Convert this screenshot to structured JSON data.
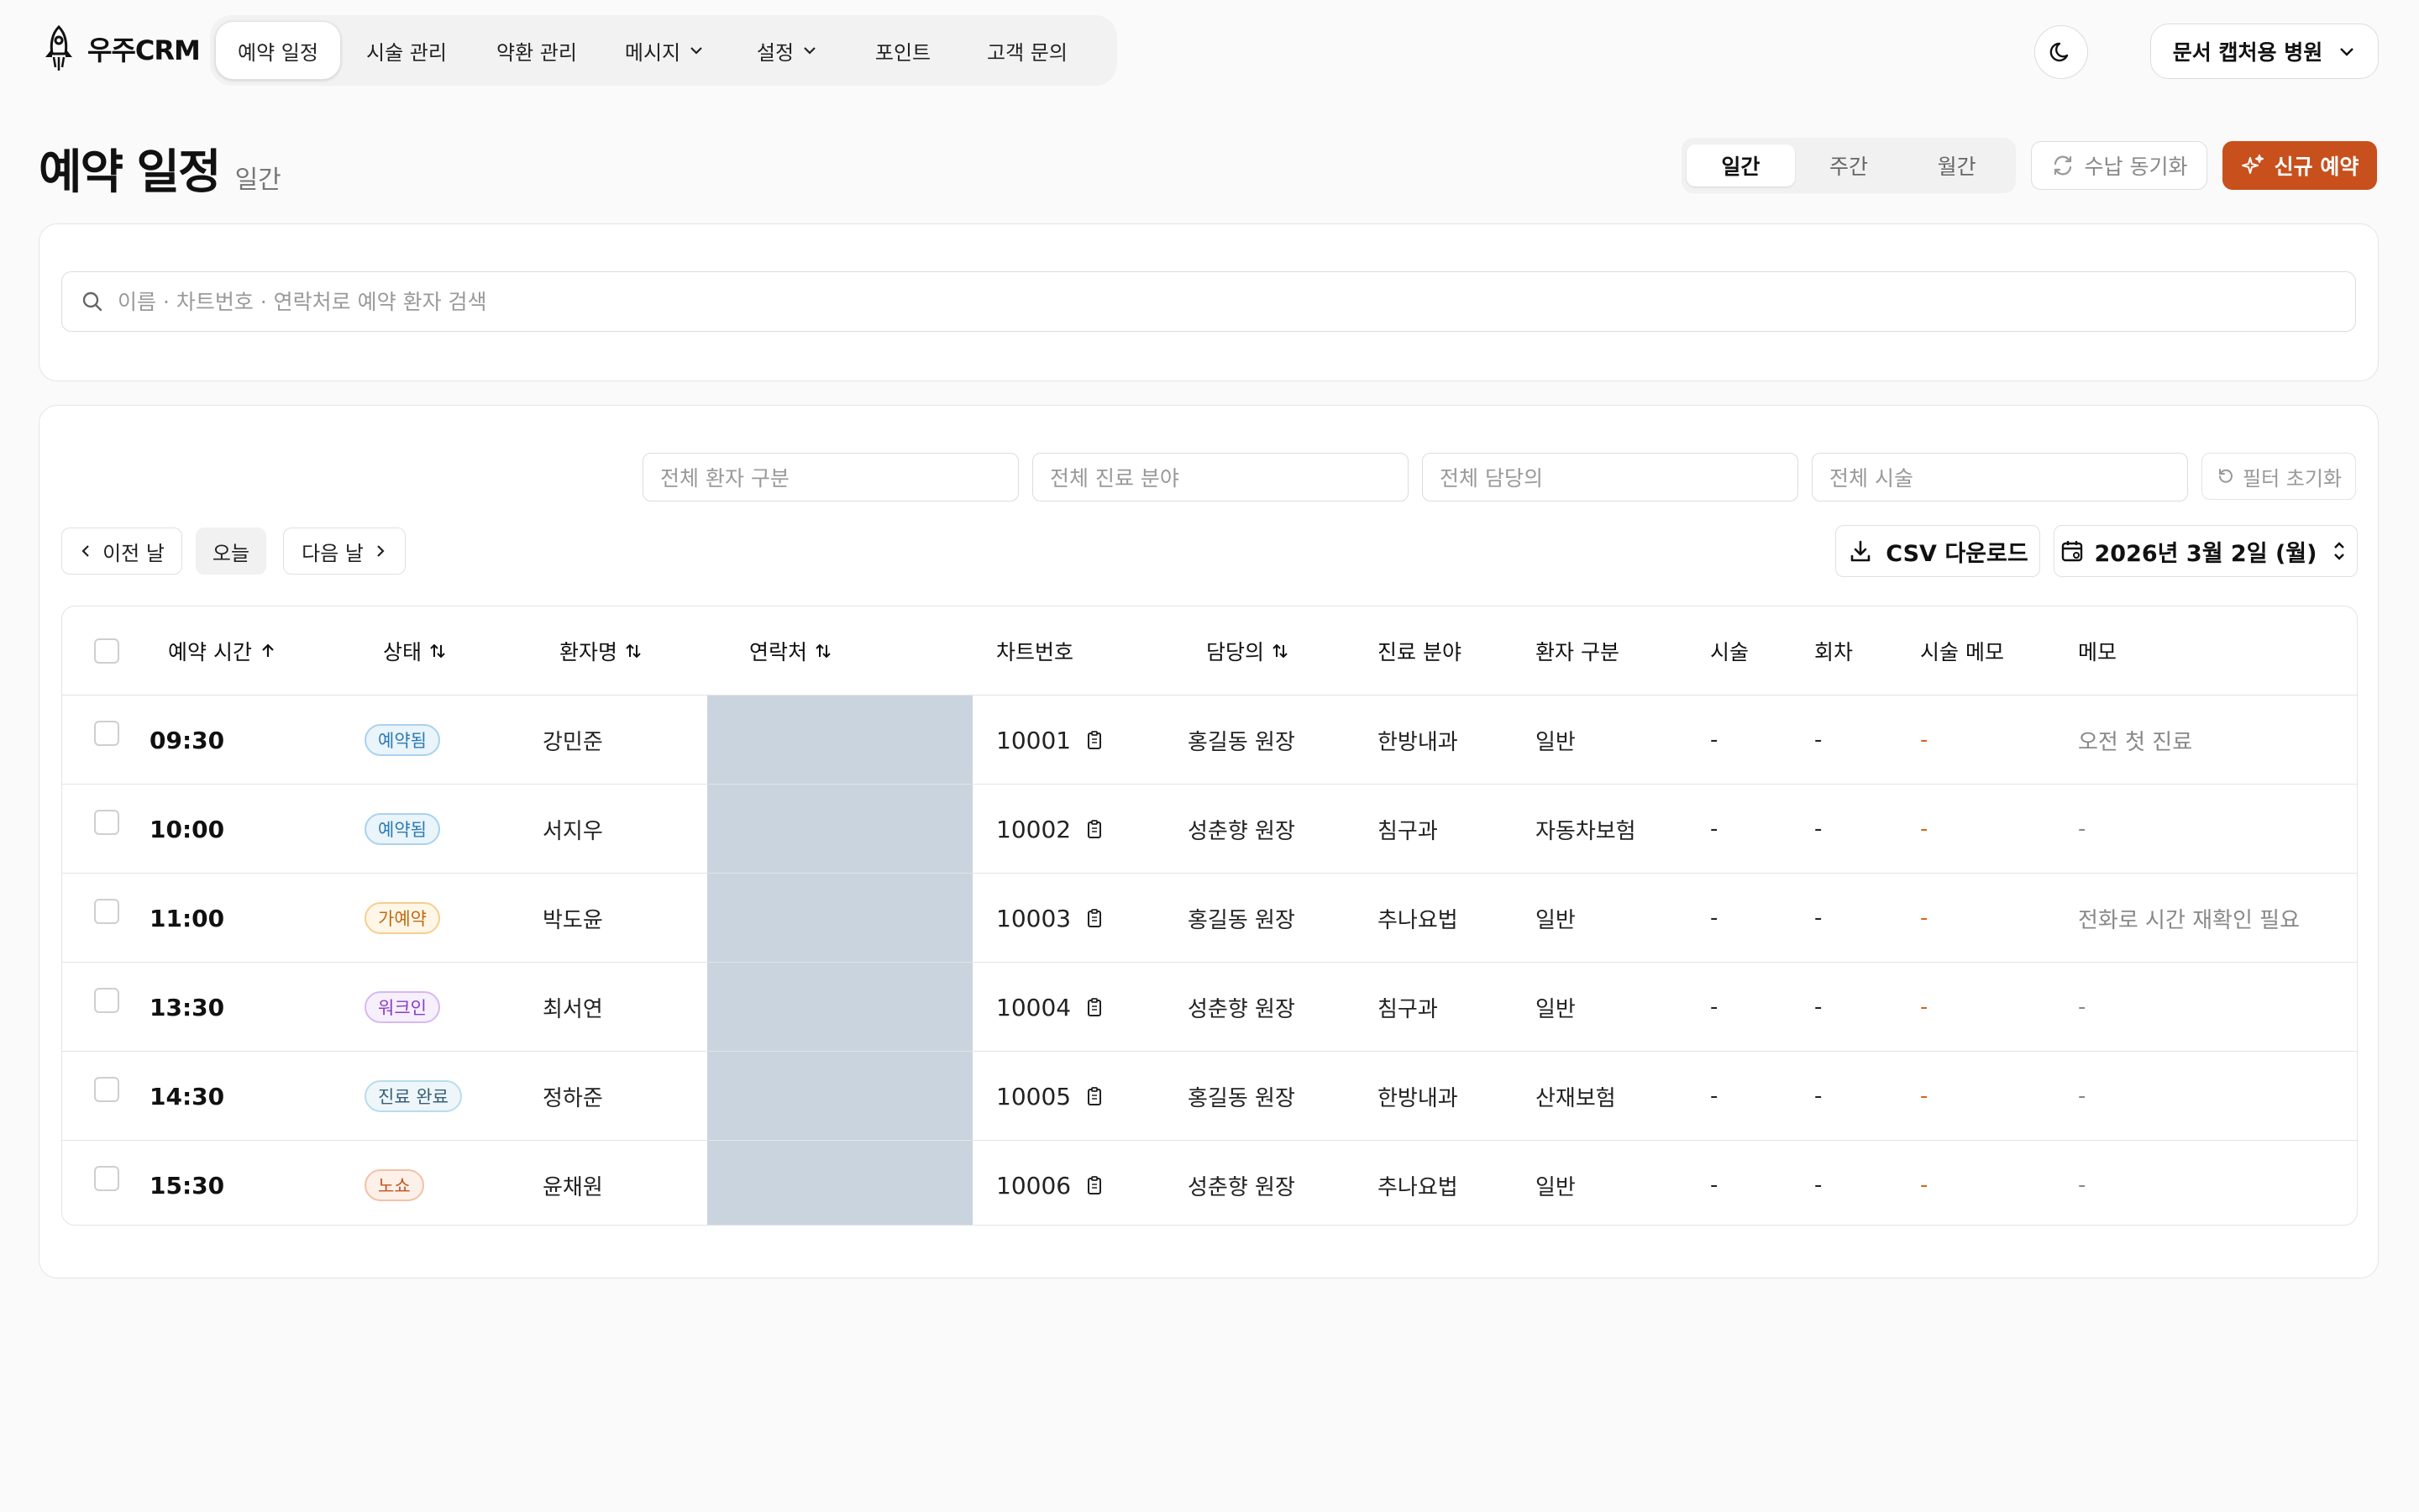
{
  "app": {
    "logo_text": "우주CRM"
  },
  "nav": {
    "items": [
      {
        "label": "예약 일정",
        "active": true
      },
      {
        "label": "시술 관리"
      },
      {
        "label": "약환 관리"
      },
      {
        "label": "메시지",
        "dropdown": true
      },
      {
        "label": "설정",
        "dropdown": true
      },
      {
        "label": "포인트"
      },
      {
        "label": "고객 문의"
      }
    ]
  },
  "header": {
    "hospital": "문서 캡처용 병원",
    "theme_icon": "moon-icon"
  },
  "page": {
    "title": "예약 일정",
    "subtitle": "일간"
  },
  "view_toggle": {
    "options": [
      "일간",
      "주간",
      "월간"
    ],
    "selected": "일간"
  },
  "actions": {
    "sync": "수납 동기화",
    "new": "신규 예약"
  },
  "search": {
    "placeholder": "이름 · 차트번호 · 연락처로 예약 환자 검색"
  },
  "filters": {
    "patient_type": "전체 환자 구분",
    "department": "전체 진료 분야",
    "doctor": "전체 담당의",
    "procedure": "전체 시술",
    "reset": "필터 초기화"
  },
  "day_nav": {
    "prev": "이전 날",
    "today": "오늘",
    "next": "다음 날"
  },
  "toolbar": {
    "csv": "CSV 다운로드",
    "date": "2026년 3월 2일 (월)"
  },
  "table": {
    "headers": {
      "time": "예약 시간",
      "status": "상태",
      "name": "환자명",
      "contact": "연락처",
      "chart": "차트번호",
      "doctor": "담당의",
      "department": "진료 분야",
      "patient_type": "환자 구분",
      "procedure": "시술",
      "session": "회차",
      "procedure_memo": "시술 메모",
      "memo": "메모"
    },
    "rows": [
      {
        "time": "09:30",
        "status": "예약됨",
        "status_color": "#2b7bb5",
        "status_bg": "#eaf4fb",
        "status_border": "#a9d2ee",
        "name": "강민준",
        "chart": "10001",
        "doctor": "홍길동 원장",
        "department": "한방내과",
        "patient_type": "일반",
        "procedure": "-",
        "session": "-",
        "procedure_memo": "-",
        "memo": "오전 첫 진료"
      },
      {
        "time": "10:00",
        "status": "예약됨",
        "status_color": "#2b7bb5",
        "status_bg": "#eaf4fb",
        "status_border": "#a9d2ee",
        "name": "서지우",
        "chart": "10002",
        "doctor": "성춘향 원장",
        "department": "침구과",
        "patient_type": "자동차보험",
        "procedure": "-",
        "session": "-",
        "procedure_memo": "-",
        "memo": "-"
      },
      {
        "time": "11:00",
        "status": "가예약",
        "status_color": "#c46a10",
        "status_bg": "#fff6e8",
        "status_border": "#f5cf8f",
        "name": "박도윤",
        "chart": "10003",
        "doctor": "홍길동 원장",
        "department": "추나요법",
        "patient_type": "일반",
        "procedure": "-",
        "session": "-",
        "procedure_memo": "-",
        "memo": "전화로 시간 재확인 필요"
      },
      {
        "time": "13:30",
        "status": "워크인",
        "status_color": "#8a3dc4",
        "status_bg": "#f6effc",
        "status_border": "#d7b9f1",
        "name": "최서연",
        "chart": "10004",
        "doctor": "성춘향 원장",
        "department": "침구과",
        "patient_type": "일반",
        "procedure": "-",
        "session": "-",
        "procedure_memo": "-",
        "memo": "-"
      },
      {
        "time": "14:30",
        "status": "진료 완료",
        "status_color": "#35607a",
        "status_bg": "#eef6fa",
        "status_border": "#b9dcec",
        "name": "정하준",
        "chart": "10005",
        "doctor": "홍길동 원장",
        "department": "한방내과",
        "patient_type": "산재보험",
        "procedure": "-",
        "session": "-",
        "procedure_memo": "-",
        "memo": "-"
      },
      {
        "time": "15:30",
        "status": "노쇼",
        "status_color": "#c4551c",
        "status_bg": "#fdf0e9",
        "status_border": "#f3c1a6",
        "name": "윤채원",
        "chart": "10006",
        "doctor": "성춘향 원장",
        "department": "추나요법",
        "patient_type": "일반",
        "procedure": "-",
        "session": "-",
        "procedure_memo": "-",
        "memo": "-"
      }
    ]
  },
  "colors": {
    "accent": "#c8501c",
    "contact_mask": "#c9d4df",
    "orange_dash": "#d9641e"
  }
}
